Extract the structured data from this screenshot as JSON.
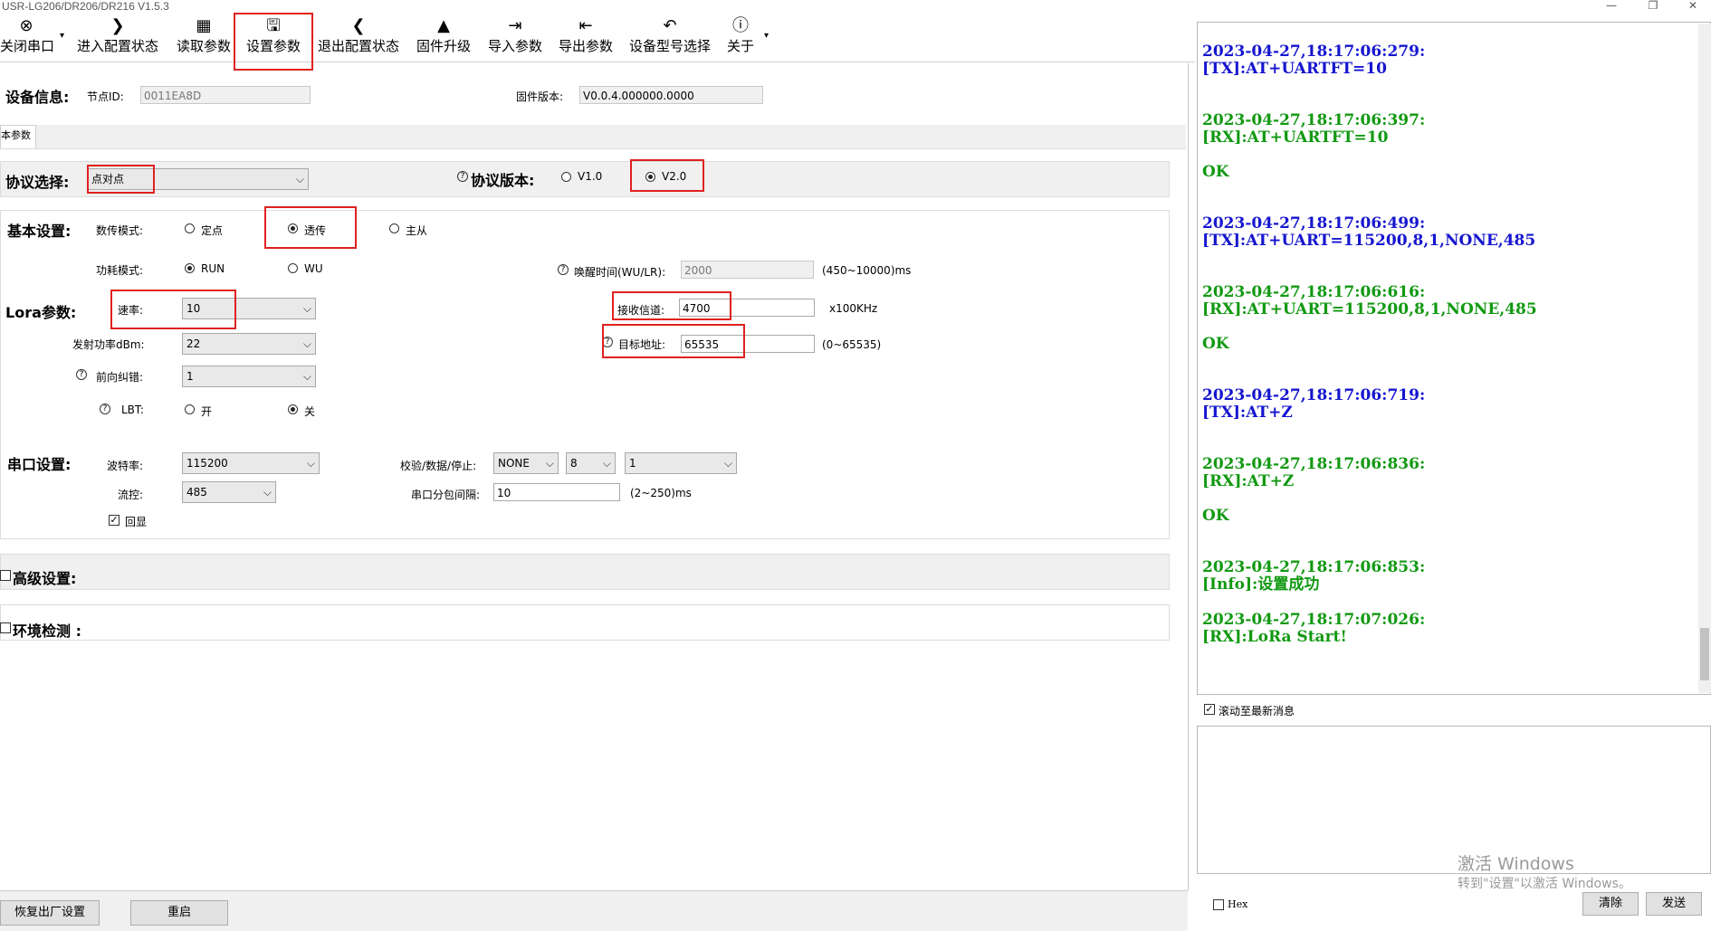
{
  "window": {
    "title": "USR-LG206/DR206/DR216 V1.5.3",
    "min": "—",
    "restore": "❐",
    "close": "✕"
  },
  "toolbar": {
    "close_port": "关闭串口",
    "enter_config": "进入配置状态",
    "read_params": "读取参数",
    "set_params": "设置参数",
    "exit_config": "退出配置状态",
    "firmware_upgrade": "固件升级",
    "import_params": "导入参数",
    "export_params": "导出参数",
    "model_select": "设备型号选择",
    "about": "关于",
    "dropdown": "▾"
  },
  "device": {
    "section": "设备信息:",
    "node_id_label": "节点ID:",
    "node_id": "0011EA8D",
    "fw_label": "固件版本:",
    "fw": "V0.0.4.000000.0000"
  },
  "tab": "本参数",
  "protocol": {
    "label": "协议选择:",
    "value": "点对点",
    "ver_label": "协议版本:",
    "v1": "V1.0",
    "v2": "V2.0"
  },
  "basic": {
    "section": "基本设置:",
    "mode_label": "数传模式:",
    "mode_fixed": "定点",
    "mode_trans": "透传",
    "mode_ms": "主从",
    "power_label": "功耗模式:",
    "power_run": "RUN",
    "power_wu": "WU",
    "wake_label": "唤醒时间(WU/LR):",
    "wake_value": "2000",
    "wake_range": "(450~10000)ms"
  },
  "lora": {
    "section": "Lora参数:",
    "rate_label": "速率:",
    "rate": "10",
    "ch_label": "接收信道:",
    "ch": "4700",
    "ch_unit": "x100KHz",
    "pwr_label": "发射功率dBm:",
    "pwr": "22",
    "addr_label": "目标地址:",
    "addr": "65535",
    "addr_range": "(0~65535)",
    "fec_label": "前向纠错:",
    "fec": "1",
    "lbt_label": "LBT:",
    "lbt_on": "开",
    "lbt_off": "关"
  },
  "serial": {
    "section": "串口设置:",
    "baud_label": "波特率:",
    "baud": "115200",
    "parity_label": "校验/数据/停止:",
    "parity": "NONE",
    "data": "8",
    "stop": "1",
    "flow_label": "流控:",
    "flow": "485",
    "interval_label": "串口分包间隔:",
    "interval": "10",
    "interval_range": "(2~250)ms",
    "echo_label": "回显"
  },
  "advanced": "高级设置:",
  "env": "环境检测 :",
  "buttons": {
    "factory": "恢复出厂设置",
    "restart": "重启",
    "clear": "清除",
    "send": "发送",
    "hex": "Hex"
  },
  "scroll_latest": "滚动至最新消息",
  "log": [
    {
      "time": "2023-04-27,18:17:06:279:",
      "msg": "[TX]:AT+UARTFT=10",
      "ok": ""
    },
    {
      "time": "2023-04-27,18:17:06:397:",
      "msg": "[RX]:AT+UARTFT=10",
      "ok": "OK"
    },
    {
      "time": "2023-04-27,18:17:06:499:",
      "msg": "[TX]:AT+UART=115200,8,1,NONE,485",
      "ok": ""
    },
    {
      "time": "2023-04-27,18:17:06:616:",
      "msg": "[RX]:AT+UART=115200,8,1,NONE,485",
      "ok": "OK"
    },
    {
      "time": "2023-04-27,18:17:06:719:",
      "msg": "[TX]:AT+Z",
      "ok": ""
    },
    {
      "time": "2023-04-27,18:17:06:836:",
      "msg": "[RX]:AT+Z",
      "ok": "OK"
    },
    {
      "time": "2023-04-27,18:17:06:853:",
      "msg": "[Info]:设置成功",
      "ok": ""
    },
    {
      "time": "2023-04-27,18:17:07:026:",
      "msg": "[RX]:LoRa Start!",
      "ok": ""
    }
  ],
  "watermark": {
    "line1": "激活 Windows",
    "line2": "转到\"设置\"以激活 Windows。"
  },
  "colors": {
    "tx": "#1515d0",
    "rx": "#119911",
    "highlight": "#e02020"
  }
}
